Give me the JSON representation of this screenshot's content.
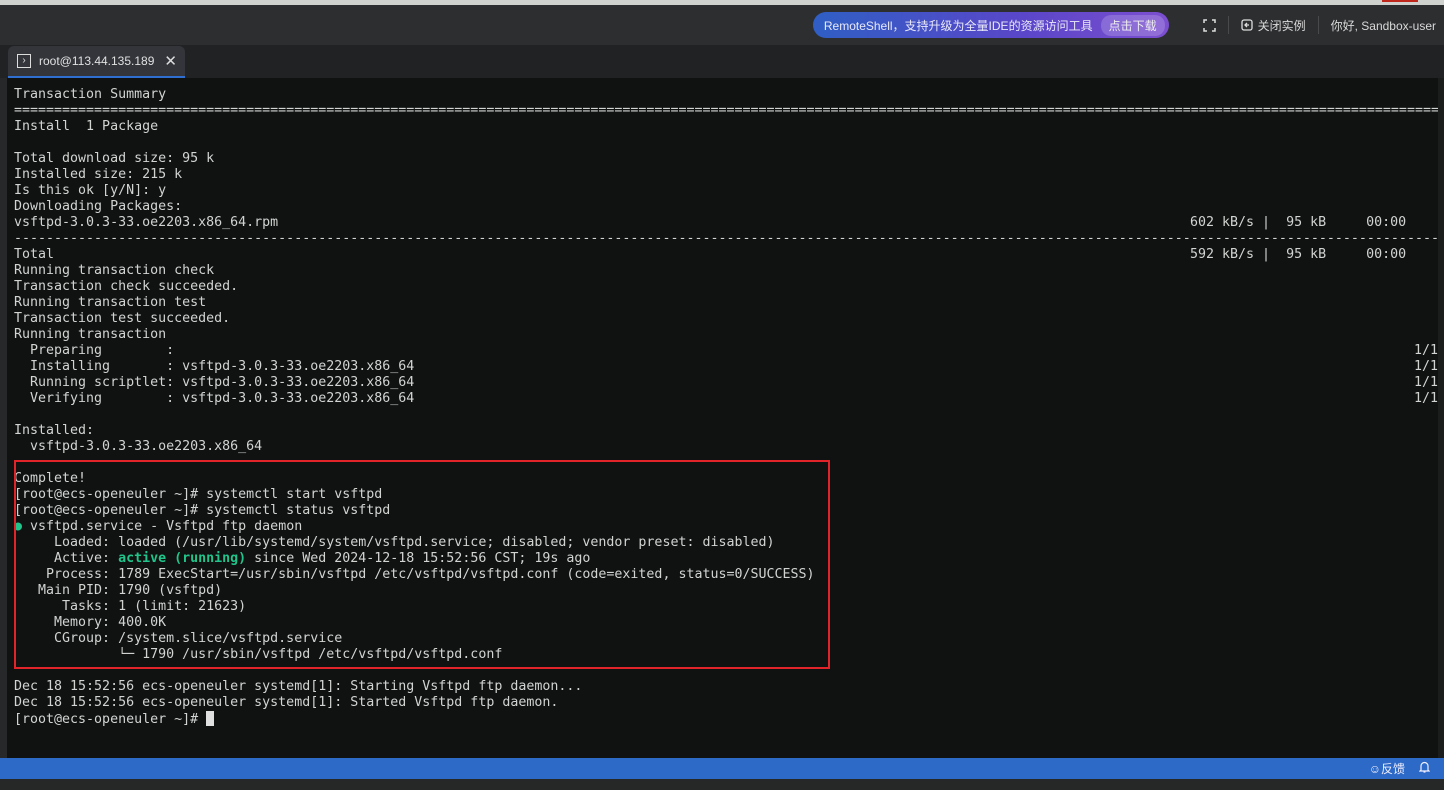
{
  "header": {
    "promo_text": "RemoteShell，支持升级为全量IDE的资源访问工具",
    "promo_button": "点击下载",
    "fullscreen_icon": "fullscreen-icon",
    "close_instance": "关闭实例",
    "greeting": "你好, Sandbox-user"
  },
  "tab": {
    "label": "root@113.44.135.189",
    "icon": "terminal-icon"
  },
  "terminal": {
    "lines": [
      {
        "t": "Transaction Summary"
      },
      {
        "t": "============================================================================================================================================================================================"
      },
      {
        "t": "Install  1 Package"
      },
      {
        "t": ""
      },
      {
        "t": "Total download size: 95 k"
      },
      {
        "t": "Installed size: 215 k"
      },
      {
        "t": "Is this ok [y/N]: y"
      },
      {
        "t": "Downloading Packages:"
      },
      {
        "t": "vsftpd-3.0.3-33.oe2203.x86_64.rpm",
        "r": "602 kB/s |  95 kB     00:00"
      },
      {
        "t": "--------------------------------------------------------------------------------------------------------------------------------------------------------------------------------------------"
      },
      {
        "t": "Total",
        "r": "592 kB/s |  95 kB     00:00"
      },
      {
        "t": "Running transaction check"
      },
      {
        "t": "Transaction check succeeded."
      },
      {
        "t": "Running transaction test"
      },
      {
        "t": "Transaction test succeeded."
      },
      {
        "t": "Running transaction"
      },
      {
        "t": "  Preparing        :",
        "r2": "1/1"
      },
      {
        "t": "  Installing       : vsftpd-3.0.3-33.oe2203.x86_64",
        "r2": "1/1"
      },
      {
        "t": "  Running scriptlet: vsftpd-3.0.3-33.oe2203.x86_64",
        "r2": "1/1"
      },
      {
        "t": "  Verifying        : vsftpd-3.0.3-33.oe2203.x86_64",
        "r2": "1/1"
      },
      {
        "t": ""
      },
      {
        "t": "Installed:"
      },
      {
        "t": "  vsftpd-3.0.3-33.oe2203.x86_64"
      },
      {
        "t": ""
      },
      {
        "t": "Complete!"
      },
      {
        "t": "[root@ecs-openeuler ~]# systemctl start vsftpd"
      },
      {
        "t": "[root@ecs-openeuler ~]# systemctl status vsftpd"
      },
      {
        "dot": "●",
        "t": " vsftpd.service - Vsftpd ftp daemon"
      },
      {
        "t": "     Loaded: loaded (/usr/lib/systemd/system/vsftpd.service; disabled; vendor preset: disabled)"
      },
      {
        "pre": "     Active: ",
        "green": "active (running)",
        "t": " since Wed 2024-12-18 15:52:56 CST; 19s ago"
      },
      {
        "t": "    Process: 1789 ExecStart=/usr/sbin/vsftpd /etc/vsftpd/vsftpd.conf (code=exited, status=0/SUCCESS)"
      },
      {
        "t": "   Main PID: 1790 (vsftpd)"
      },
      {
        "t": "      Tasks: 1 (limit: 21623)"
      },
      {
        "t": "     Memory: 400.0K"
      },
      {
        "t": "     CGroup: /system.slice/vsftpd.service"
      },
      {
        "t": "             └─ 1790 /usr/sbin/vsftpd /etc/vsftpd/vsftpd.conf"
      },
      {
        "t": ""
      },
      {
        "t": "Dec 18 15:52:56 ecs-openeuler systemd[1]: Starting Vsftpd ftp daemon..."
      },
      {
        "t": "Dec 18 15:52:56 ecs-openeuler systemd[1]: Started Vsftpd ftp daemon."
      },
      {
        "t": "[root@ecs-openeuler ~]# ",
        "cursor": true
      }
    ]
  },
  "statusbar": {
    "feedback": "☺反馈",
    "bell_icon": "bell-icon"
  },
  "colors": {
    "accent": "#2d6ac8",
    "highlight_box": "#e0242a",
    "active_green": "#21c48a"
  }
}
